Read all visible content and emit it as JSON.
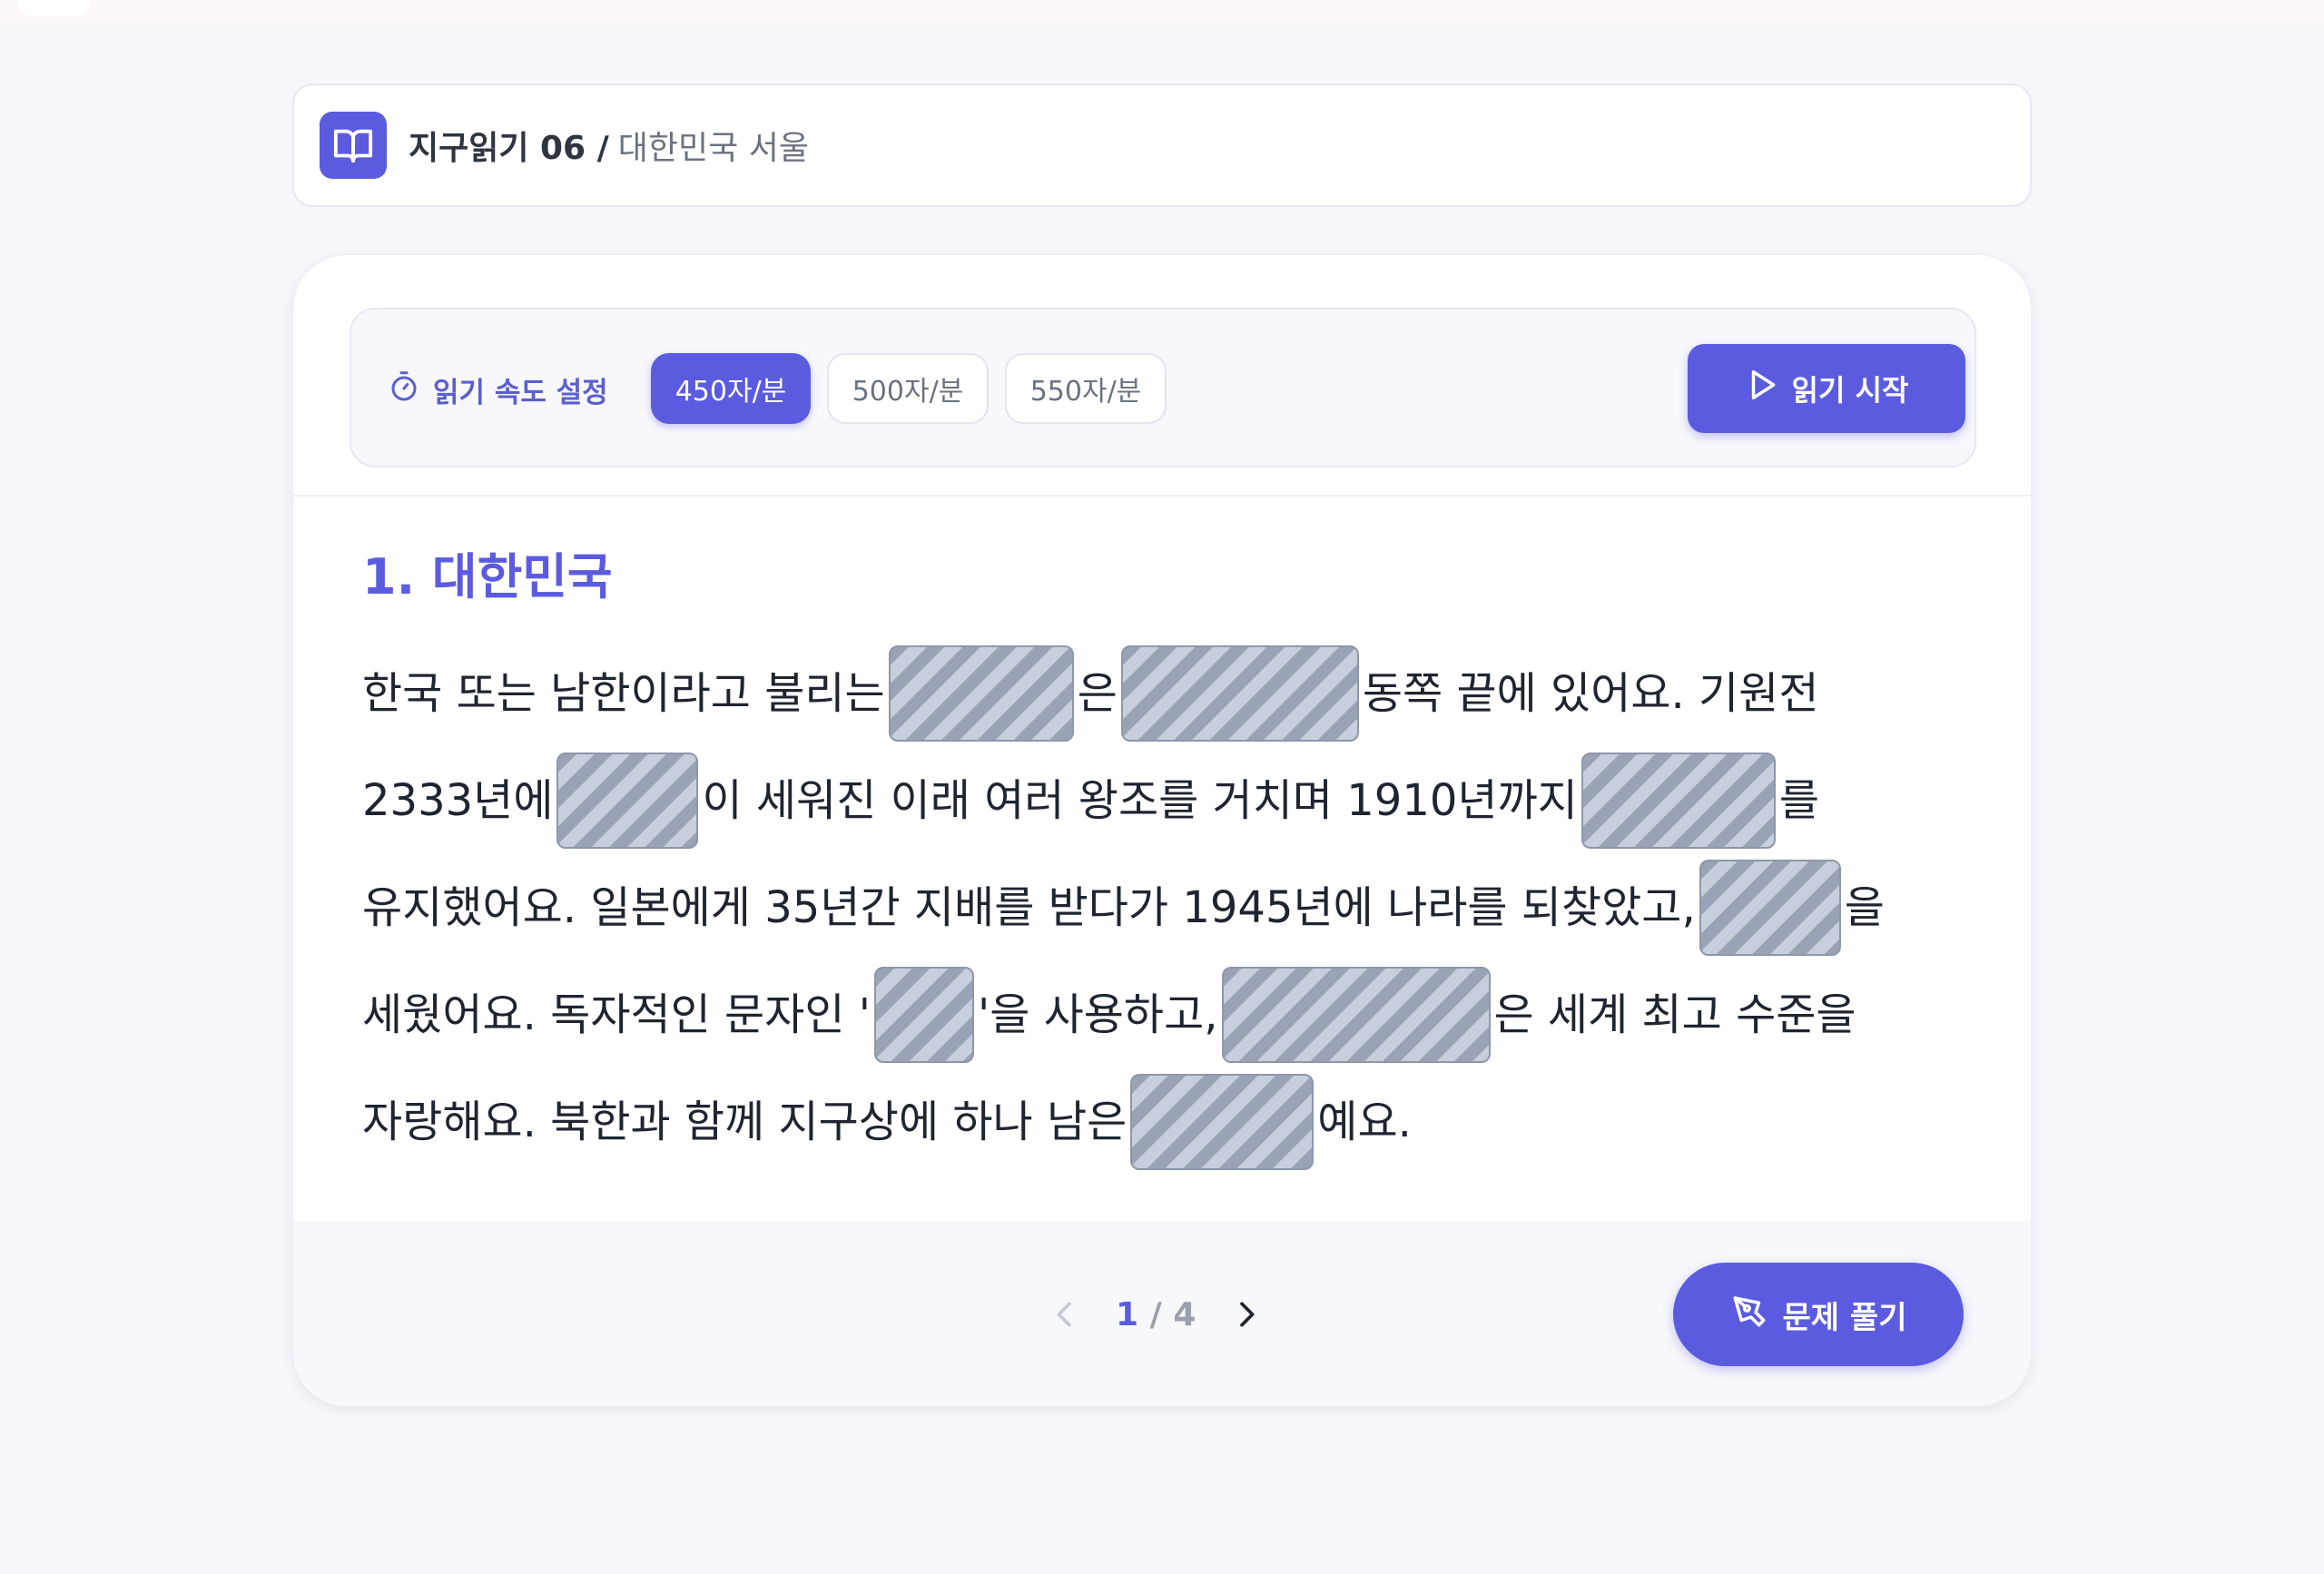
{
  "header": {
    "title": "지구읽기 06 /",
    "subtitle": "대한민국 서울",
    "icon": "open-book-icon"
  },
  "speed": {
    "label": "읽기 속도 설정",
    "icon": "stopwatch-icon",
    "options": [
      "450자/분",
      "500자/분",
      "550자/분"
    ],
    "selected": "450자/분",
    "start_label": "읽기 시작",
    "start_icon": "play-icon"
  },
  "section": {
    "title": "1. 대한민국"
  },
  "passage": {
    "lines": [
      [
        "한국 또는 남한이라고 불리는",
        "은",
        "동쪽 끝에 있어요. 기원전"
      ],
      [
        "2333년에",
        "이 세워진 이래 여러 왕조를 거치며 1910년까지",
        "를"
      ],
      [
        "유지했어요. 일본에게 35년간 지배를 받다가 1945년에 나라를 되찾았고,",
        "을"
      ],
      [
        "세웠어요. 독자적인 문자인 '",
        "'을 사용하고,",
        "은 세계 최고 수준을"
      ],
      [
        "자랑해요. 북한과 함께 지구상에 하나 남은",
        "예요."
      ]
    ],
    "blank_count": 9
  },
  "pager": {
    "current": "1",
    "separator": "/",
    "total": "4"
  },
  "solve": {
    "label": "문제 풀기",
    "icon": "pen-tool-icon"
  },
  "colors": {
    "accent": "#5b5be0",
    "background": "#f6f6fb",
    "blank_dark": "#9aa3b6",
    "blank_light": "#c7cfdc"
  }
}
